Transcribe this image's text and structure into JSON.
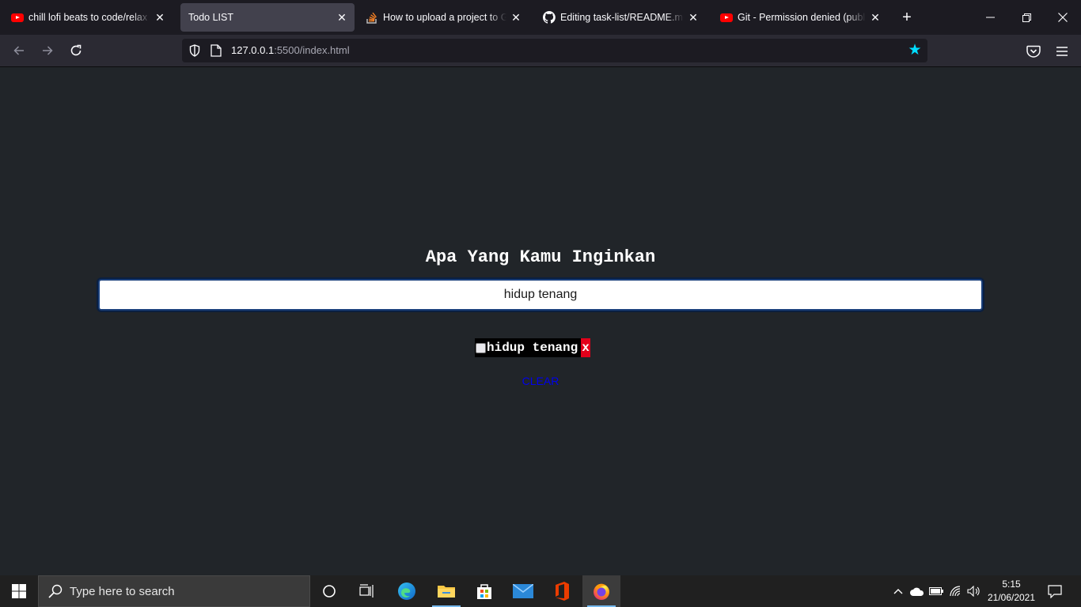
{
  "browser": {
    "tabs": [
      {
        "title": "chill lofi beats to code/relax to",
        "favicon": "youtube-icon"
      },
      {
        "title": "Todo LIST",
        "favicon": "none",
        "active": true
      },
      {
        "title": "How to upload a project to Github",
        "favicon": "stackoverflow-icon"
      },
      {
        "title": "Editing task-list/README.md at",
        "favicon": "github-icon"
      },
      {
        "title": "Git - Permission denied (publickey)",
        "favicon": "youtube-icon"
      }
    ],
    "url_host": "127.0.0.1",
    "url_path": ":5500/index.html"
  },
  "page": {
    "heading": "Apa Yang Kamu Inginkan",
    "input_value": "hidup tenang",
    "tasks": [
      {
        "text": "hidup tenang",
        "delete_label": "x",
        "checked": false
      }
    ],
    "clear_label": "CLEAR"
  },
  "taskbar": {
    "search_placeholder": "Type here to search",
    "time": "5:15",
    "date": "21/06/2021"
  },
  "colors": {
    "page_bg": "#212529",
    "delete_bg": "#e2001a",
    "clear_link": "#0000ee",
    "bookmark_star": "#00ddff"
  }
}
